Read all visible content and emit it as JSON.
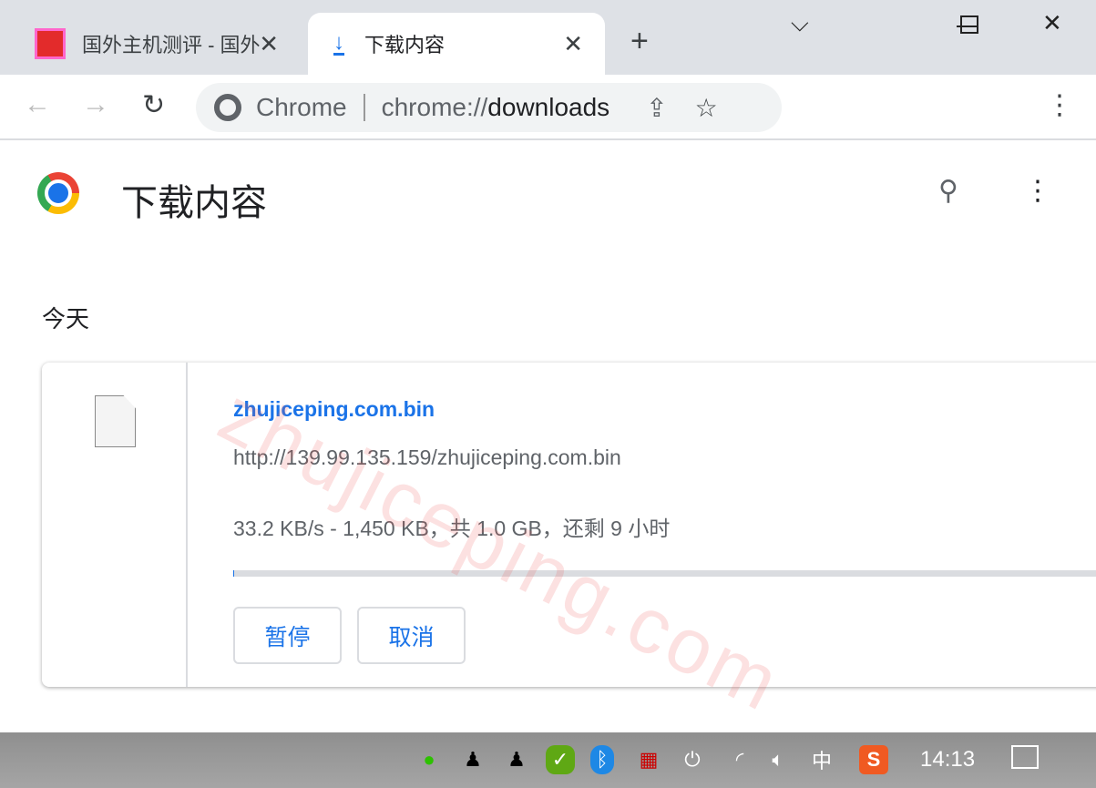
{
  "tabs": [
    {
      "label": "国外主机测评 - 国外",
      "favicon": "site-favicon",
      "active": false
    },
    {
      "label": "下载内容",
      "favicon": "download-icon",
      "active": true
    }
  ],
  "omnibox": {
    "chip": "Chrome",
    "url_prefix": "chrome://",
    "url_path": "downloads"
  },
  "page": {
    "title": "下载内容",
    "section": "今天"
  },
  "download": {
    "filename": "zhujiceping.com.bin",
    "url": "http://139.99.135.159/zhujiceping.com.bin",
    "status": "33.2 KB/s - 1,450 KB，共 1.0 GB，还剩 9 小时",
    "progress_percent": 0.14,
    "pause_label": "暂停",
    "cancel_label": "取消"
  },
  "watermark": "zhujiceping.com",
  "taskbar": {
    "clock": "14:13",
    "ime": "中",
    "tray_icons": [
      "wechat-icon",
      "qq-icon",
      "qq-icon",
      "security-icon",
      "bluetooth-icon",
      "app-icon",
      "power-icon",
      "wifi-icon",
      "volume-icon",
      "ime-icon",
      "sogou-icon",
      "notification-icon"
    ]
  },
  "colors": {
    "accent": "#1a73e8",
    "tabstrip": "#dee1e6"
  }
}
